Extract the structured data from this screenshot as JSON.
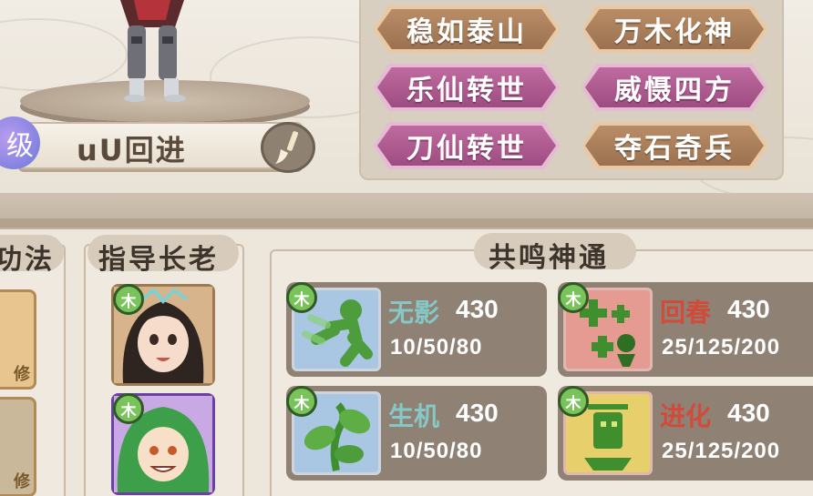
{
  "player": {
    "level_char": "级",
    "name": "uU回进"
  },
  "titles": [
    {
      "label": "稳如泰山",
      "style": "brown"
    },
    {
      "label": "万木化神",
      "style": "brown"
    },
    {
      "label": "乐仙转世",
      "style": "pink"
    },
    {
      "label": "威慑四方",
      "style": "pink"
    },
    {
      "label": "刀仙转世",
      "style": "pink"
    },
    {
      "label": "夺石奇兵",
      "style": "brown"
    }
  ],
  "sections": {
    "gongfa": "功法",
    "elder": "指导长老",
    "resonance": "共鸣神通"
  },
  "left_cards": [
    {
      "badge": "修"
    },
    {
      "badge": "修"
    }
  ],
  "elders": [
    {
      "element": "木",
      "icon": "female-elder-portrait"
    },
    {
      "element": "木",
      "icon": "green-hair-elder-portrait"
    }
  ],
  "skills": [
    {
      "element": "木",
      "name": "无影",
      "level": "430",
      "stats": "10/50/80",
      "icon": "running-figure-icon",
      "color": "blue"
    },
    {
      "element": "木",
      "name": "回春",
      "level": "430",
      "stats": "25/125/200",
      "icon": "healing-cross-icon",
      "color": "red"
    },
    {
      "element": "木",
      "name": "生机",
      "level": "430",
      "stats": "10/50/80",
      "icon": "sprout-icon",
      "color": "blue"
    },
    {
      "element": "木",
      "name": "进化",
      "level": "430",
      "stats": "25/125/200",
      "icon": "evolution-totem-icon",
      "color": "red"
    }
  ]
}
